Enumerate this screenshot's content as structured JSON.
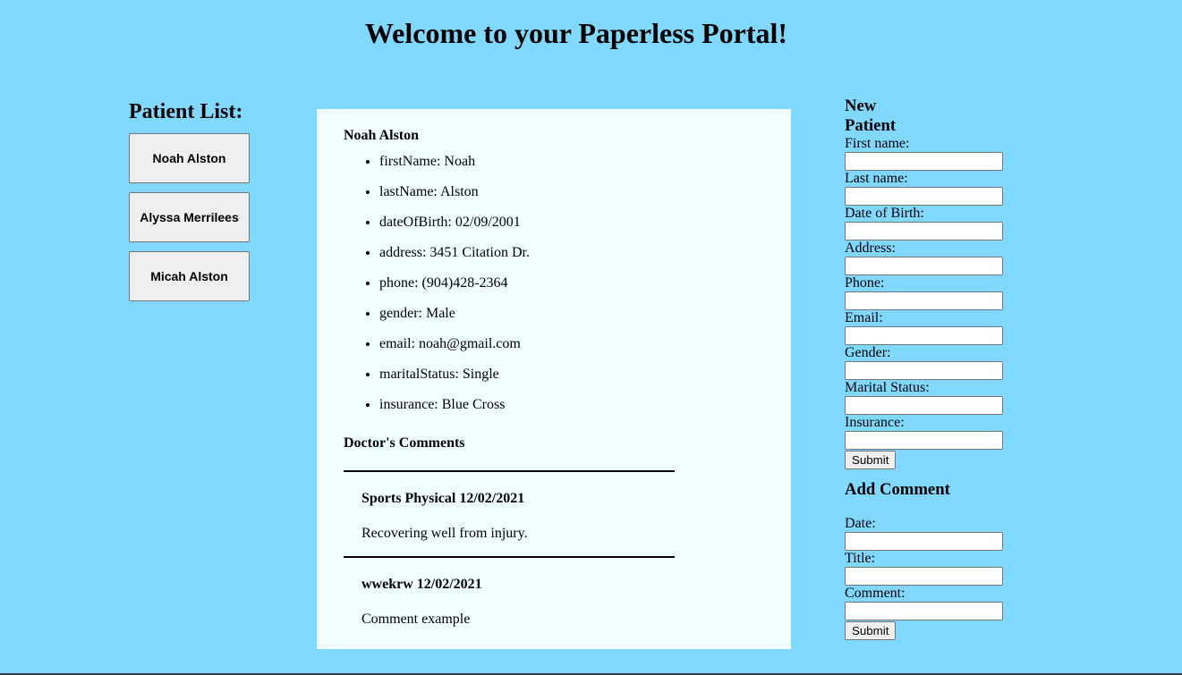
{
  "page": {
    "title": "Welcome to your Paperless Portal!"
  },
  "patient_list": {
    "heading": "Patient List:",
    "patients": [
      "Noah Alston",
      "Alyssa Merrilees",
      "Micah Alston"
    ]
  },
  "details": {
    "name": "Noah Alston",
    "attributes": [
      "firstName: Noah",
      "lastName: Alston",
      "dateOfBirth: 02/09/2001",
      "address: 3451 Citation Dr.",
      "phone: (904)428-2364",
      "gender: Male",
      "email: noah@gmail.com",
      "maritalStatus: Single",
      "insurance: Blue Cross"
    ],
    "comments_heading": "Doctor's Comments",
    "comments": [
      {
        "title": "Sports Physical 12/02/2021",
        "body": "Recovering well from injury."
      },
      {
        "title": "wwekrw 12/02/2021",
        "body": "Comment example"
      }
    ]
  },
  "new_patient_form": {
    "title": "New Patient",
    "fields": [
      {
        "label": "First name:",
        "value": ""
      },
      {
        "label": "Last name:",
        "value": ""
      },
      {
        "label": "Date of Birth:",
        "value": ""
      },
      {
        "label": "Address:",
        "value": ""
      },
      {
        "label": "Phone:",
        "value": ""
      },
      {
        "label": "Email:",
        "value": ""
      },
      {
        "label": "Gender:",
        "value": ""
      },
      {
        "label": "Marital Status:",
        "value": ""
      },
      {
        "label": "Insurance:",
        "value": ""
      }
    ],
    "submit_label": "Submit"
  },
  "add_comment_form": {
    "title": "Add Comment",
    "fields": [
      {
        "label": "Date:",
        "value": ""
      },
      {
        "label": "Title:",
        "value": ""
      },
      {
        "label": "Comment:",
        "value": ""
      }
    ],
    "submit_label": "Submit"
  },
  "colors": {
    "background": "#80d8ff",
    "panel": "#f0ffff"
  }
}
